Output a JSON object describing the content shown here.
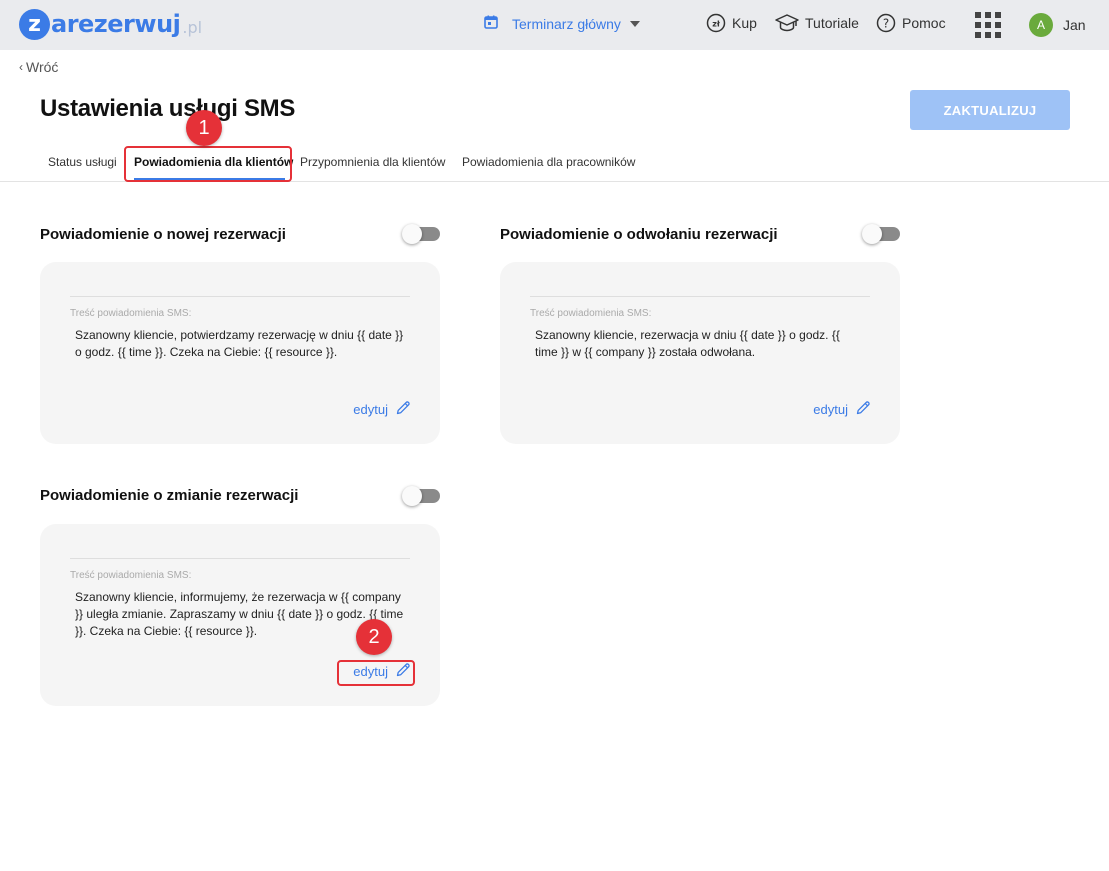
{
  "topbar": {
    "logo_letter": "z",
    "logo_text": "arezerwuj",
    "logo_suffix": ".pl",
    "calendar_label": "Terminarz główny",
    "buy_label": "Kup",
    "tutorials_label": "Tutoriale",
    "help_label": "Pomoc",
    "user_initial": "A",
    "user_name": "Jan"
  },
  "header": {
    "back_label": "Wróć",
    "title": "Ustawienia usługi SMS",
    "update_button": "ZAKTUALIZUJ"
  },
  "tabs": [
    {
      "label": "Status usługi",
      "active": false
    },
    {
      "label": "Powiadomienia dla klientów",
      "active": true
    },
    {
      "label": "Przypomnienia dla klientów",
      "active": false
    },
    {
      "label": "Powiadomienia dla pracowników",
      "active": false
    }
  ],
  "annotations": {
    "marker_1": "1",
    "marker_2": "2",
    "highlight_color": "#e53138"
  },
  "notifications": [
    {
      "title": "Powiadomienie o nowej rezerwacji",
      "enabled": false,
      "field_label": "Treść powiadomienia SMS:",
      "message": "Szanowny kliencie, potwierdzamy rezerwację w dniu {{ date }} o godz. {{ time }}. Czeka na Ciebie: {{ resource }}.",
      "edit_label": "edytuj"
    },
    {
      "title": "Powiadomienie o odwołaniu rezerwacji",
      "enabled": false,
      "field_label": "Treść powiadomienia SMS:",
      "message": "Szanowny kliencie, rezerwacja w dniu {{ date }} o godz. {{ time }} w {{ company }} została odwołana.",
      "edit_label": "edytuj"
    },
    {
      "title": "Powiadomienie o zmianie rezerwacji",
      "enabled": false,
      "field_label": "Treść powiadomienia SMS:",
      "message": "Szanowny kliencie, informujemy, że rezerwacja w {{ company }} uległa zmianie. Zapraszamy w dniu {{ date }} o godz. {{ time }}. Czeka na Ciebie: {{ resource }}.",
      "edit_label": "edytuj"
    }
  ],
  "colors": {
    "brand": "#3b7be6",
    "button_disabled": "#9ec2f6",
    "topbar_bg": "#eaebee",
    "card_bg": "#f5f5f5"
  }
}
